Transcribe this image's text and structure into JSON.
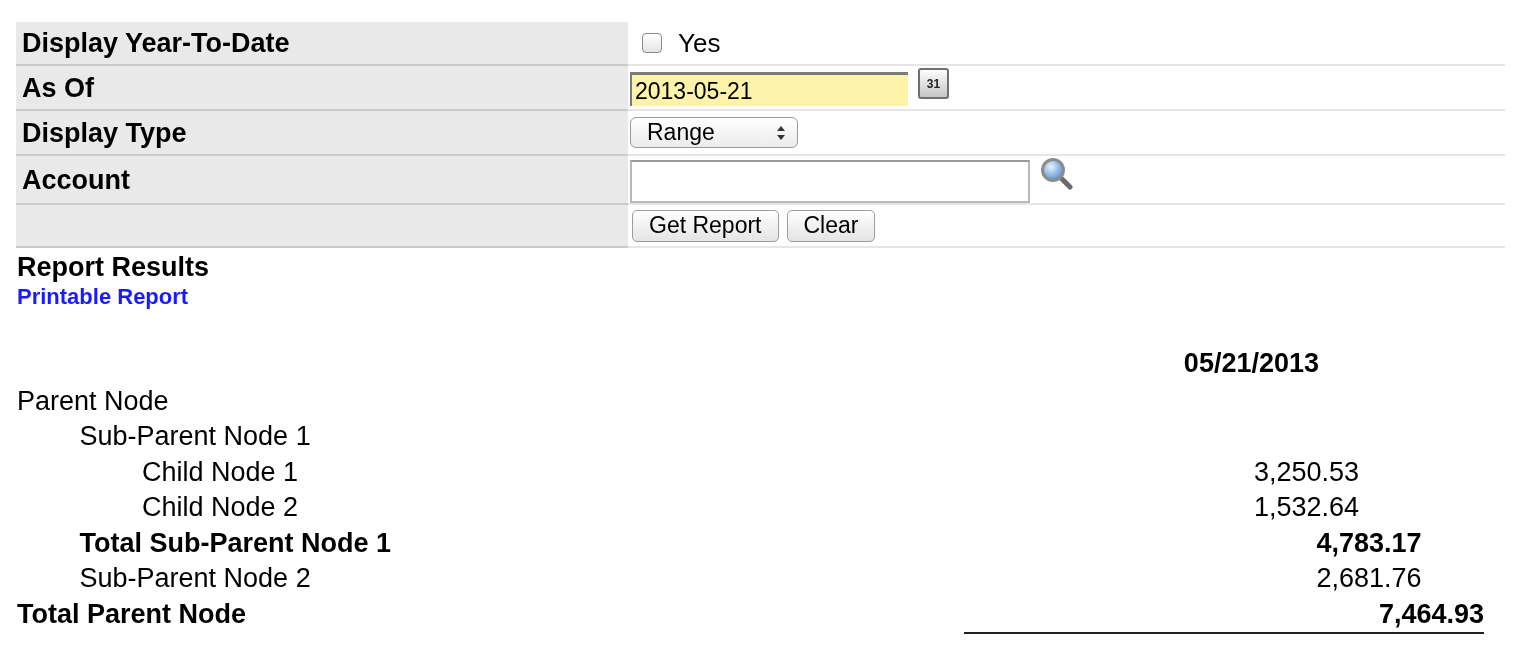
{
  "form": {
    "rows": [
      {
        "kind": "checkbox",
        "label": "Display Year-To-Date",
        "option": "Yes",
        "checked": false
      },
      {
        "kind": "date",
        "label": "As Of",
        "value": "2013-05-21",
        "highlighted": true,
        "picker": "31"
      },
      {
        "kind": "select",
        "label": "Display Type",
        "value": "Range"
      },
      {
        "kind": "lookup",
        "label": "Account"
      },
      {
        "kind": "buttons",
        "buttons": [
          "Get Report",
          "Clear"
        ]
      }
    ]
  },
  "results": {
    "title": "Report Results",
    "link": "Printable Report",
    "column_header": "05/21/2013",
    "tree": [
      {
        "label": "Parent Node",
        "children": [
          {
            "label": "Sub-Parent Node 1",
            "children": [
              {
                "label": "Child Node 1",
                "value": "3,250.53"
              },
              {
                "label": "Child Node 2",
                "value": "1,532.64"
              }
            ],
            "total": {
              "label": "Total Sub-Parent Node 1",
              "value": "4,783.17"
            }
          },
          {
            "label": "Sub-Parent Node 2",
            "value": "2,681.76"
          }
        ],
        "total": {
          "label": "Total Parent Node",
          "value": "7,464.93"
        }
      }
    ]
  }
}
